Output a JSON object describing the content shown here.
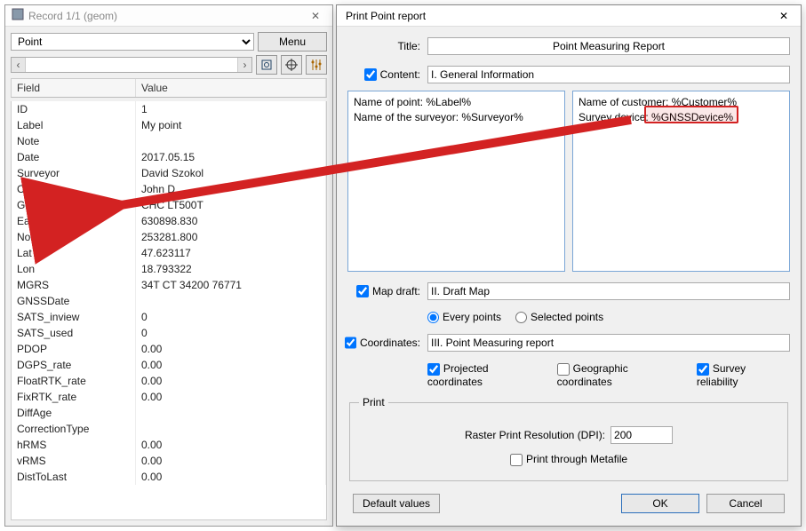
{
  "left": {
    "title": "Record 1/1 (geom)",
    "type": "Point",
    "menu": "Menu",
    "columns": {
      "field": "Field",
      "value": "Value"
    },
    "rows": [
      {
        "f": "ID",
        "v": "1"
      },
      {
        "f": "Label",
        "v": "My point"
      },
      {
        "f": "Note",
        "v": ""
      },
      {
        "f": "Date",
        "v": "2017.05.15"
      },
      {
        "f": "Surveyor",
        "v": "David Szokol"
      },
      {
        "f": "Customer",
        "v": "John D"
      },
      {
        "f": "GNSSDevice",
        "v": "CHC LT500T"
      },
      {
        "f": "Easting",
        "v": "630898.830"
      },
      {
        "f": "Northing",
        "v": "253281.800"
      },
      {
        "f": "Lat",
        "v": "47.623117"
      },
      {
        "f": "Lon",
        "v": "18.793322"
      },
      {
        "f": "MGRS",
        "v": "34T CT 34200 76771"
      },
      {
        "f": "GNSSDate",
        "v": ""
      },
      {
        "f": "SATS_inview",
        "v": "0"
      },
      {
        "f": "SATS_used",
        "v": "0"
      },
      {
        "f": "PDOP",
        "v": "0.00"
      },
      {
        "f": "DGPS_rate",
        "v": "0.00"
      },
      {
        "f": "FloatRTK_rate",
        "v": "0.00"
      },
      {
        "f": "FixRTK_rate",
        "v": "0.00"
      },
      {
        "f": "DiffAge",
        "v": ""
      },
      {
        "f": "CorrectionType",
        "v": ""
      },
      {
        "f": "hRMS",
        "v": "0.00"
      },
      {
        "f": "vRMS",
        "v": "0.00"
      },
      {
        "f": "DistToLast",
        "v": "0.00"
      }
    ]
  },
  "right": {
    "title": "Print Point report",
    "labels": {
      "title": "Title:",
      "content": "Content:",
      "mapdraft": "Map draft:",
      "coordinates": "Coordinates:",
      "every": "Every points",
      "selected": "Selected points",
      "projected": "Projected coordinates",
      "geographic": "Geographic coordinates",
      "reliability": "Survey reliability",
      "printFieldset": "Print",
      "dpi": "Raster Print Resolution (DPI):",
      "metafile": "Print through Metafile",
      "defaults": "Default values",
      "ok": "OK",
      "cancel": "Cancel"
    },
    "values": {
      "title": "Point Measuring Report",
      "content": "I. General Information",
      "mapdraft": "II. Draft Map",
      "coordinates": "III. Point Measuring report",
      "dpi": "200"
    },
    "leftPane": "Name of point: %Label%\nName of the surveyor: %Surveyor%",
    "rightPane": {
      "line1": "Name of customer: %Customer%",
      "line2a": "Survey device: ",
      "line2b": "%GNSSDevice%"
    },
    "checks": {
      "content": true,
      "mapdraft": true,
      "coordinates": true,
      "projected": true,
      "geographic": false,
      "reliability": true,
      "metafile": false
    },
    "radios": {
      "every": true,
      "selected": false
    }
  }
}
